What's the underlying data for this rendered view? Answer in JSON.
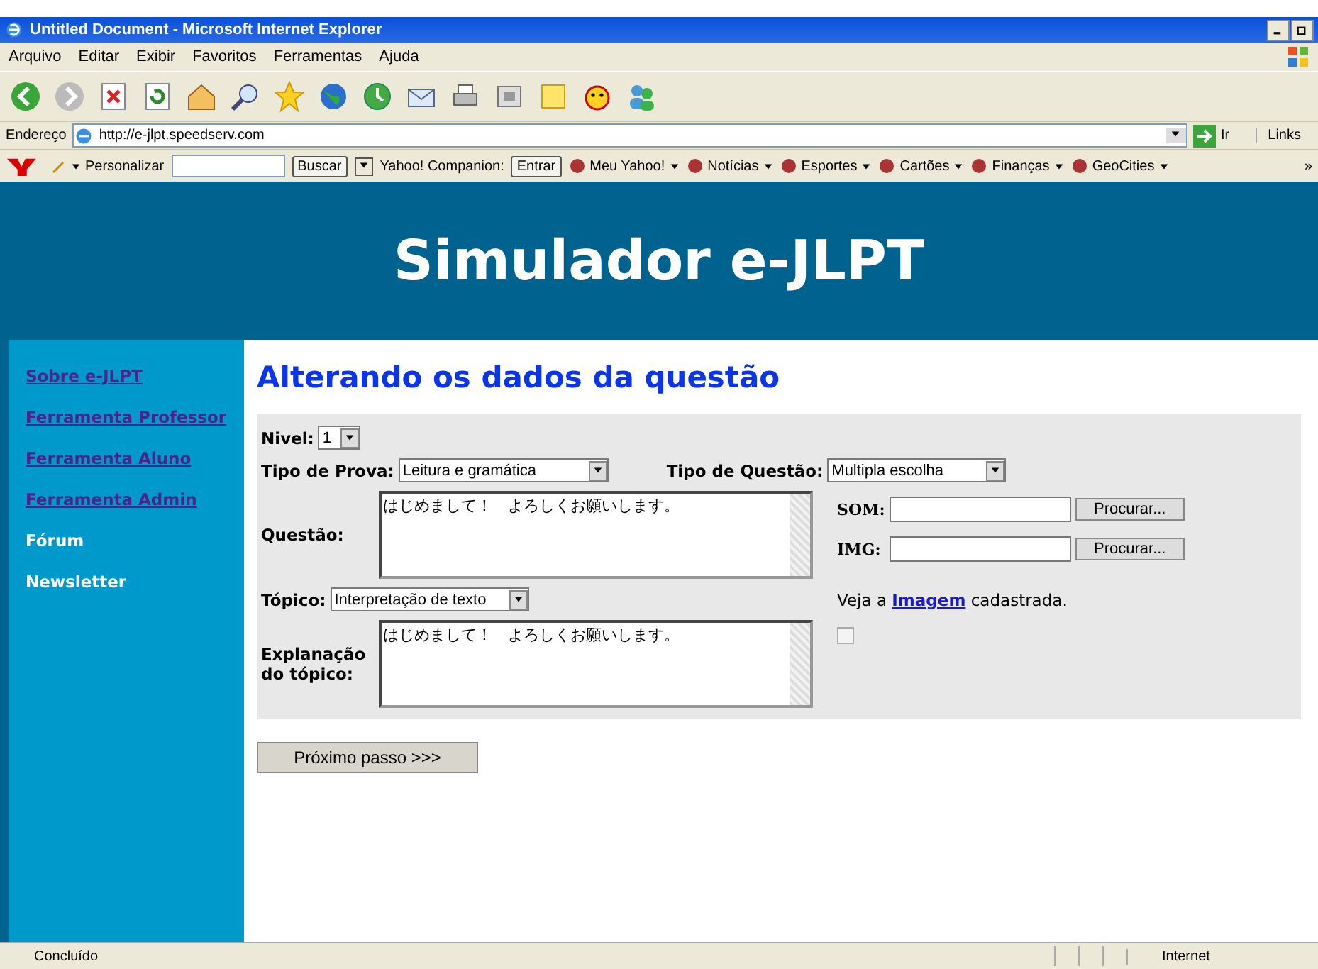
{
  "window": {
    "title": "Untitled Document - Microsoft Internet Explorer"
  },
  "menu": [
    "Arquivo",
    "Editar",
    "Exibir",
    "Favoritos",
    "Ferramentas",
    "Ajuda"
  ],
  "address_bar": {
    "label": "Endereço",
    "url": "http://e-jlpt.speedserv.com",
    "go": "Ir",
    "links": "Links"
  },
  "yahoo_toolbar": {
    "customize": "Personalizar",
    "search_button": "Buscar",
    "companion": "Yahoo! Companion:",
    "signin": "Entrar",
    "items": [
      "Meu Yahoo!",
      "Notícias",
      "Esportes",
      "Cartões",
      "Finanças",
      "GeoCities"
    ],
    "more": "»"
  },
  "page": {
    "header": "Simulador e-JLPT",
    "sidebar": [
      {
        "label": "Sobre e-JLPT",
        "link": true
      },
      {
        "label": "Ferramenta Professor",
        "link": true
      },
      {
        "label": "Ferramenta Aluno",
        "link": true
      },
      {
        "label": "Ferramenta Admin",
        "link": true
      },
      {
        "label": "Fórum",
        "link": false
      },
      {
        "label": "Newsletter",
        "link": false
      }
    ],
    "title": "Alterando os dados da questão",
    "form": {
      "nivel": {
        "label": "Nivel:",
        "value": "1"
      },
      "tipo_prova": {
        "label": "Tipo de Prova:",
        "value": "Leitura e gramática"
      },
      "tipo_questao": {
        "label": "Tipo de Questão:",
        "value": "Multipla escolha"
      },
      "questao": {
        "label": "Questão:",
        "value": "はじめまして！　よろしくお願いします。"
      },
      "som": {
        "label": "SOM:",
        "button": "Procurar..."
      },
      "img": {
        "label": "IMG:",
        "button": "Procurar..."
      },
      "topico": {
        "label": "Tópico:",
        "value": "Interpretação de texto"
      },
      "image_note": {
        "before": "Veja a",
        "link": "Imagem",
        "after": "cadastrada."
      },
      "explanacao": {
        "label": "Explanação do tópico:",
        "value": "はじめまして！　よろしくお願いします。"
      }
    },
    "next_button": "Próximo passo >>>"
  },
  "status_bar": {
    "text": "Concluído",
    "zone": "Internet"
  }
}
